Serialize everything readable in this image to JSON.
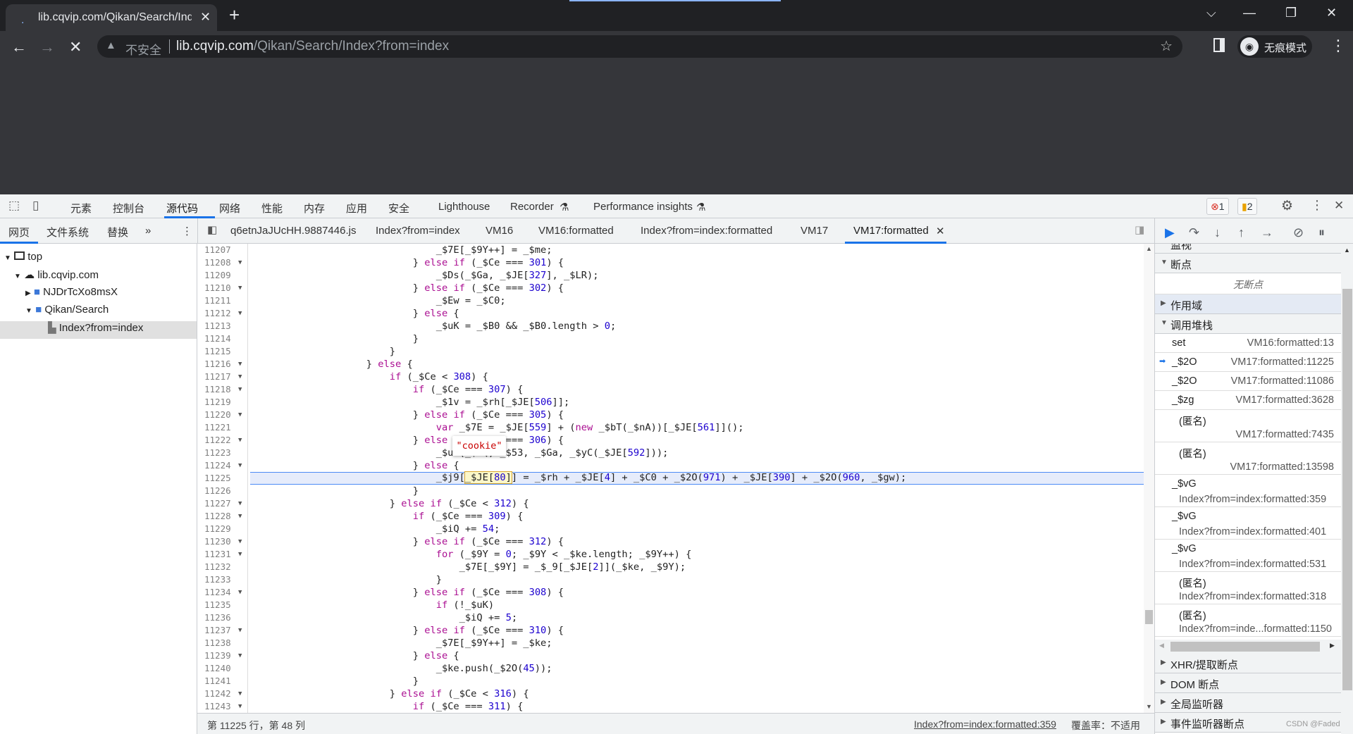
{
  "browser": {
    "tab_title": "lib.cqvip.com/Qikan/Search/Index?from=index",
    "security_label": "不安全",
    "url_host": "lib.cqvip.com",
    "url_path": "/Qikan/Search/Index?from=index",
    "incognito_label": "无痕模式"
  },
  "devtools": {
    "panels": [
      "元素",
      "控制台",
      "源代码",
      "网络",
      "性能",
      "内存",
      "应用",
      "安全",
      "Lighthouse",
      "Recorder",
      "Performance insights"
    ],
    "active_panel": "源代码",
    "error_count": "1",
    "warning_count": "2",
    "navigator_tabs": [
      "网页",
      "文件系统",
      "替换"
    ],
    "more": "»",
    "tree": [
      {
        "label": "top",
        "icon": "frame-icon"
      },
      {
        "label": "lib.cqvip.com",
        "icon": "cloud-icon"
      },
      {
        "label": "NJDrTcXo8msX",
        "icon": "folder-icon"
      },
      {
        "label": "Qikan/Search",
        "icon": "folder-icon"
      },
      {
        "label": "Index?from=index",
        "icon": "file-icon"
      }
    ],
    "file_tabs": [
      "q6etnJaJUcHH.9887446.js",
      "Index?from=index",
      "VM16",
      "VM16:formatted",
      "Index?from=index:formatted",
      "VM17",
      "VM17:formatted"
    ],
    "active_file_tab": "VM17:formatted",
    "code": {
      "first_line": 11207,
      "current_line": 11225,
      "lines": [
        {
          "indent": 32,
          "text": "_$7E[_$9Y++] = _$me;"
        },
        {
          "indent": 28,
          "text": "} else if (_$Ce === 301) {",
          "fold": true
        },
        {
          "indent": 32,
          "text": "_$Ds(_$Ga, _$JE[327], _$LR);"
        },
        {
          "indent": 28,
          "text": "} else if (_$Ce === 302) {",
          "fold": true
        },
        {
          "indent": 32,
          "text": "_$Ew = _$C0;"
        },
        {
          "indent": 28,
          "text": "} else {",
          "fold": true
        },
        {
          "indent": 32,
          "text": "_$uK = _$B0 && _$B0.length > 0;"
        },
        {
          "indent": 28,
          "text": "}"
        },
        {
          "indent": 24,
          "text": "}"
        },
        {
          "indent": 20,
          "text": "} else {",
          "fold": true
        },
        {
          "indent": 24,
          "text": "if (_$Ce < 308) {",
          "fold": true
        },
        {
          "indent": 28,
          "text": "if (_$Ce === 307) {",
          "fold": true
        },
        {
          "indent": 32,
          "text": "_$1v = _$rh[_$JE[506]];"
        },
        {
          "indent": 28,
          "text": "} else if (_$Ce === 305) {",
          "fold": true
        },
        {
          "indent": 32,
          "text": "var _$7E = _$JE[559] + (new _$bT(_$nA))[_$JE[561]]();"
        },
        {
          "indent": 28,
          "text": "} else if (_$Ce === 306) {",
          "fold": true
        },
        {
          "indent": 32,
          "text": "_$uK(_$iQ, _$53, _$Ga, _$yC(_$JE[592]));"
        },
        {
          "indent": 28,
          "text": "} else {",
          "fold": true
        },
        {
          "indent": 32,
          "text": "_$j9[_$JE[80]] = _$rh + _$JE[4] + _$C0 + _$2O(971) + _$JE[390] + _$2O(960, _$gw);"
        },
        {
          "indent": 28,
          "text": "}"
        },
        {
          "indent": 24,
          "text": "} else if (_$Ce < 312) {",
          "fold": true
        },
        {
          "indent": 28,
          "text": "if (_$Ce === 309) {",
          "fold": true
        },
        {
          "indent": 32,
          "text": "_$iQ += 54;"
        },
        {
          "indent": 28,
          "text": "} else if (_$Ce === 312) {",
          "fold": true
        },
        {
          "indent": 32,
          "text": "for (_$9Y = 0; _$9Y < _$ke.length; _$9Y++) {",
          "fold": true
        },
        {
          "indent": 36,
          "text": "_$7E[_$9Y] = _$_9[_$JE[2]](_$ke, _$9Y);"
        },
        {
          "indent": 32,
          "text": "}"
        },
        {
          "indent": 28,
          "text": "} else if (_$Ce === 308) {",
          "fold": true
        },
        {
          "indent": 32,
          "text": "if (!_$uK)"
        },
        {
          "indent": 36,
          "text": "_$iQ += 5;"
        },
        {
          "indent": 28,
          "text": "} else if (_$Ce === 310) {",
          "fold": true
        },
        {
          "indent": 32,
          "text": "_$7E[_$9Y++] = _$ke;"
        },
        {
          "indent": 28,
          "text": "} else {",
          "fold": true
        },
        {
          "indent": 32,
          "text": "_$ke.push(_$2O(45));"
        },
        {
          "indent": 28,
          "text": "}"
        },
        {
          "indent": 24,
          "text": "} else if (_$Ce < 316) {",
          "fold": true
        },
        {
          "indent": 28,
          "text": "if (_$Ce === 311) {",
          "fold": true
        }
      ],
      "hover_expression": "_$JE[80]",
      "hover_value": "\"cookie\""
    },
    "status": {
      "position": "第 11225 行，第 48 列",
      "source_link": "Index?from=index:formatted:359",
      "coverage": "覆盖率：不适用"
    },
    "sidebar": {
      "watch": "监视",
      "breakpoints": "断点",
      "no_breakpoints": "无断点",
      "scope": "作用域",
      "call_stack": "调用堆栈",
      "frames": [
        {
          "fn": "set",
          "loc": "VM16:formatted:13"
        },
        {
          "fn": "_$2O",
          "loc": "VM17:formatted:11225",
          "current": true
        },
        {
          "fn": "_$2O",
          "loc": "VM17:formatted:11086"
        },
        {
          "fn": "_$zg",
          "loc": "VM17:formatted:3628"
        },
        {
          "fn": "(匿名)",
          "loc": "VM17:formatted:7435"
        },
        {
          "fn": "(匿名)",
          "loc": "VM17:formatted:13598"
        },
        {
          "fn": "_$vG",
          "loc": "Index?from=index:formatted:359"
        },
        {
          "fn": "_$vG",
          "loc": "Index?from=index:formatted:401"
        },
        {
          "fn": "_$vG",
          "loc": "Index?from=index:formatted:531"
        },
        {
          "fn": "(匿名)",
          "loc": "Index?from=index:formatted:318"
        },
        {
          "fn": "(匿名)",
          "loc": "Index?from=inde...formatted:1150"
        }
      ],
      "xhr": "XHR/提取断点",
      "dom": "DOM 断点",
      "global": "全局监听器",
      "event": "事件监听器断点"
    },
    "watermark": "CSDN @Faded"
  },
  "colors": {
    "accent": "#1a73e8",
    "keyword": "#aa0d91",
    "number": "#1c00cf",
    "hover_value": "#c80000"
  }
}
